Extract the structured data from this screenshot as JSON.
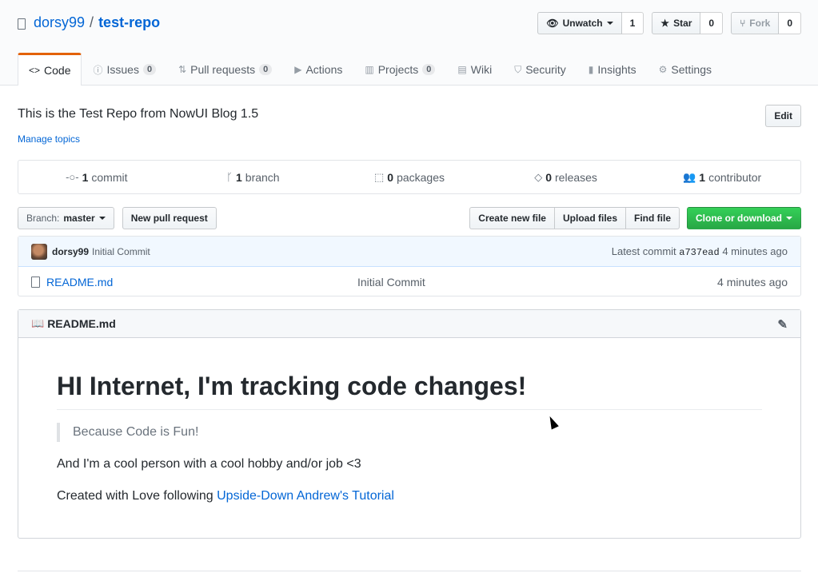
{
  "repo": {
    "owner": "dorsy99",
    "separator": "/",
    "name": "test-repo"
  },
  "actions": {
    "watch": {
      "label": "Unwatch",
      "count": "1"
    },
    "star": {
      "label": "Star",
      "count": "0"
    },
    "fork": {
      "label": "Fork",
      "count": "0"
    }
  },
  "tabs": [
    {
      "label": "Code",
      "icon": "code-icon"
    },
    {
      "label": "Issues",
      "count": "0",
      "icon": "issue-icon"
    },
    {
      "label": "Pull requests",
      "count": "0",
      "icon": "pull-request-icon"
    },
    {
      "label": "Actions",
      "icon": "play-icon"
    },
    {
      "label": "Projects",
      "count": "0",
      "icon": "project-icon"
    },
    {
      "label": "Wiki",
      "icon": "book-icon"
    },
    {
      "label": "Security",
      "icon": "shield-icon"
    },
    {
      "label": "Insights",
      "icon": "graph-icon"
    },
    {
      "label": "Settings",
      "icon": "gear-icon"
    }
  ],
  "about": {
    "description": "This is the Test Repo from NowUI Blog 1.5",
    "manage_topics": "Manage topics",
    "edit": "Edit"
  },
  "summary": {
    "commits": {
      "num": "1",
      "label": "commit"
    },
    "branches": {
      "num": "1",
      "label": "branch"
    },
    "packages": {
      "num": "0",
      "label": "packages"
    },
    "releases": {
      "num": "0",
      "label": "releases"
    },
    "contributors": {
      "num": "1",
      "label": "contributor"
    }
  },
  "toolbar": {
    "branch_prefix": "Branch:",
    "branch_name": "master",
    "new_pr": "New pull request",
    "create_file": "Create new file",
    "upload": "Upload files",
    "find": "Find file",
    "clone": "Clone or download"
  },
  "latest_commit": {
    "author": "dorsy99",
    "message": "Initial Commit",
    "prefix": "Latest commit",
    "sha": "a737ead",
    "age": "4 minutes ago"
  },
  "files": [
    {
      "name": "README.md",
      "message": "Initial Commit",
      "age": "4 minutes ago"
    }
  ],
  "readme": {
    "filename": "README.md",
    "heading": "HI Internet, I'm tracking code changes!",
    "quote": "Because Code is Fun!",
    "para1": "And I'm a cool person with a cool hobby and/or job <3",
    "para2_prefix": "Created with Love following ",
    "para2_link": "Upside-Down Andrew's Tutorial"
  },
  "colors": {
    "accent_tab": "#e36209",
    "link": "#0366d6",
    "green": "#28a745"
  }
}
